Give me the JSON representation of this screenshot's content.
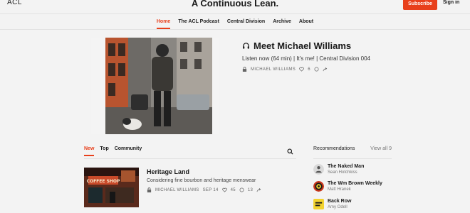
{
  "header": {
    "logo": "ACL",
    "site_title": "A Continuous Lean.",
    "subscribe_label": "Subscribe",
    "signin_label": "Sign in"
  },
  "nav": [
    "Home",
    "The ACL Podcast",
    "Central Division",
    "Archive",
    "About"
  ],
  "hero": {
    "title": "Meet Michael Williams",
    "subtitle": "Listen now (64 min) | It's me! | Central Division 004",
    "author": "MICHAEL WILLIAMS",
    "likes": "6"
  },
  "tabs": [
    "New",
    "Top",
    "Community"
  ],
  "post": {
    "title": "Heritage Land",
    "subtitle": "Considering fine bourbon and heritage menswear",
    "author": "MICHAEL WILLIAMS",
    "date": "SEP 14",
    "likes": "45",
    "comments": "13",
    "sign_text": "COFFEE SHOP"
  },
  "recommendations": {
    "heading": "Recommendations",
    "view_all": "View all 9",
    "items": [
      {
        "name": "The Naked Man",
        "author": "Sean Hotchkiss",
        "color": "#d9d9d9"
      },
      {
        "name": "The Wm Brown Weekly",
        "author": "Matt Hranek",
        "color": "#c9361b"
      },
      {
        "name": "Back Row",
        "author": "Amy Odell",
        "color": "#f2d22e"
      }
    ]
  },
  "colors": {
    "accent": "#e8401c"
  }
}
